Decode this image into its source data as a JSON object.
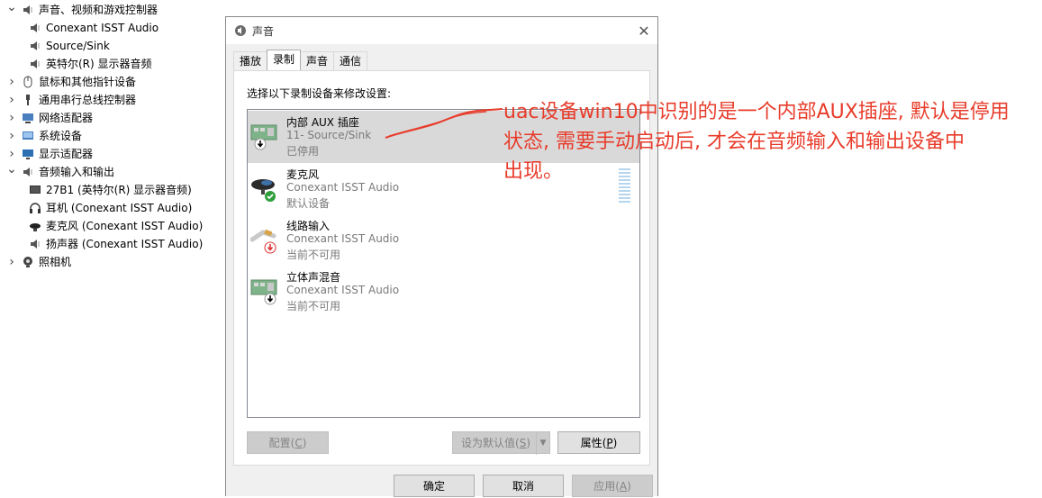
{
  "tree": {
    "items": [
      {
        "label": "声音、视频和游戏控制器",
        "level": 0,
        "expanded": true,
        "icon": "speaker-icon"
      },
      {
        "label": "Conexant ISST Audio",
        "level": 1,
        "icon": "speaker-icon"
      },
      {
        "label": "Source/Sink",
        "level": 1,
        "icon": "speaker-icon"
      },
      {
        "label": "英特尔(R) 显示器音频",
        "level": 1,
        "icon": "speaker-icon"
      },
      {
        "label": "鼠标和其他指针设备",
        "level": 0,
        "expanded": false,
        "icon": "mouse-icon"
      },
      {
        "label": "通用串行总线控制器",
        "level": 0,
        "expanded": false,
        "icon": "usb-icon"
      },
      {
        "label": "网络适配器",
        "level": 0,
        "expanded": false,
        "icon": "network-icon"
      },
      {
        "label": "系统设备",
        "level": 0,
        "expanded": false,
        "icon": "system-icon"
      },
      {
        "label": "显示适配器",
        "level": 0,
        "expanded": false,
        "icon": "display-icon"
      },
      {
        "label": "音频输入和输出",
        "level": 0,
        "expanded": true,
        "icon": "speaker-icon"
      },
      {
        "label": "27B1 (英特尔(R) 显示器音频)",
        "level": 1,
        "icon": "monitor-icon"
      },
      {
        "label": "耳机 (Conexant ISST Audio)",
        "level": 1,
        "icon": "headphones-icon"
      },
      {
        "label": "麦克风 (Conexant ISST Audio)",
        "level": 1,
        "icon": "microphone-icon"
      },
      {
        "label": "扬声器 (Conexant ISST Audio)",
        "level": 1,
        "icon": "speaker-icon"
      },
      {
        "label": "照相机",
        "level": 0,
        "expanded": false,
        "icon": "camera-icon"
      }
    ]
  },
  "dialog": {
    "title": "声音",
    "close": "✕",
    "tabs": [
      "播放",
      "录制",
      "声音",
      "通信"
    ],
    "active_tab": "录制",
    "instruction": "选择以下录制设备来修改设置:",
    "devices": [
      {
        "name": "内部 AUX 插座",
        "sub": "11- Source/Sink",
        "status": "已停用",
        "icon": "line-in-board-icon",
        "badge": "down-arrow",
        "selected": true
      },
      {
        "name": "麦克风",
        "sub": "Conexant ISST Audio",
        "status": "默认设备",
        "icon": "microphone-icon",
        "badge": "check",
        "selected": false
      },
      {
        "name": "线路输入",
        "sub": "Conexant ISST Audio",
        "status": "当前不可用",
        "icon": "line-in-cable-icon",
        "badge": "red-down-arrow",
        "selected": false
      },
      {
        "name": "立体声混音",
        "sub": "Conexant ISST Audio",
        "status": "当前不可用",
        "icon": "line-in-board-icon",
        "badge": "down-arrow",
        "selected": false
      }
    ],
    "buttons": {
      "configure": "配置",
      "configure_key": "C",
      "set_default": "设为默认值",
      "set_default_key": "S",
      "properties": "属性",
      "properties_key": "P",
      "ok": "确定",
      "cancel": "取消",
      "apply": "应用",
      "apply_key": "A"
    }
  },
  "annotation": {
    "text_line1": "uac设备win10中识别的是一个内部AUX插座, 默认是停用",
    "text_line2": "状态, 需要手动启动后, 才会在音频输入和输出设备中",
    "text_line3": "出现。",
    "color": "#e83c2b"
  }
}
